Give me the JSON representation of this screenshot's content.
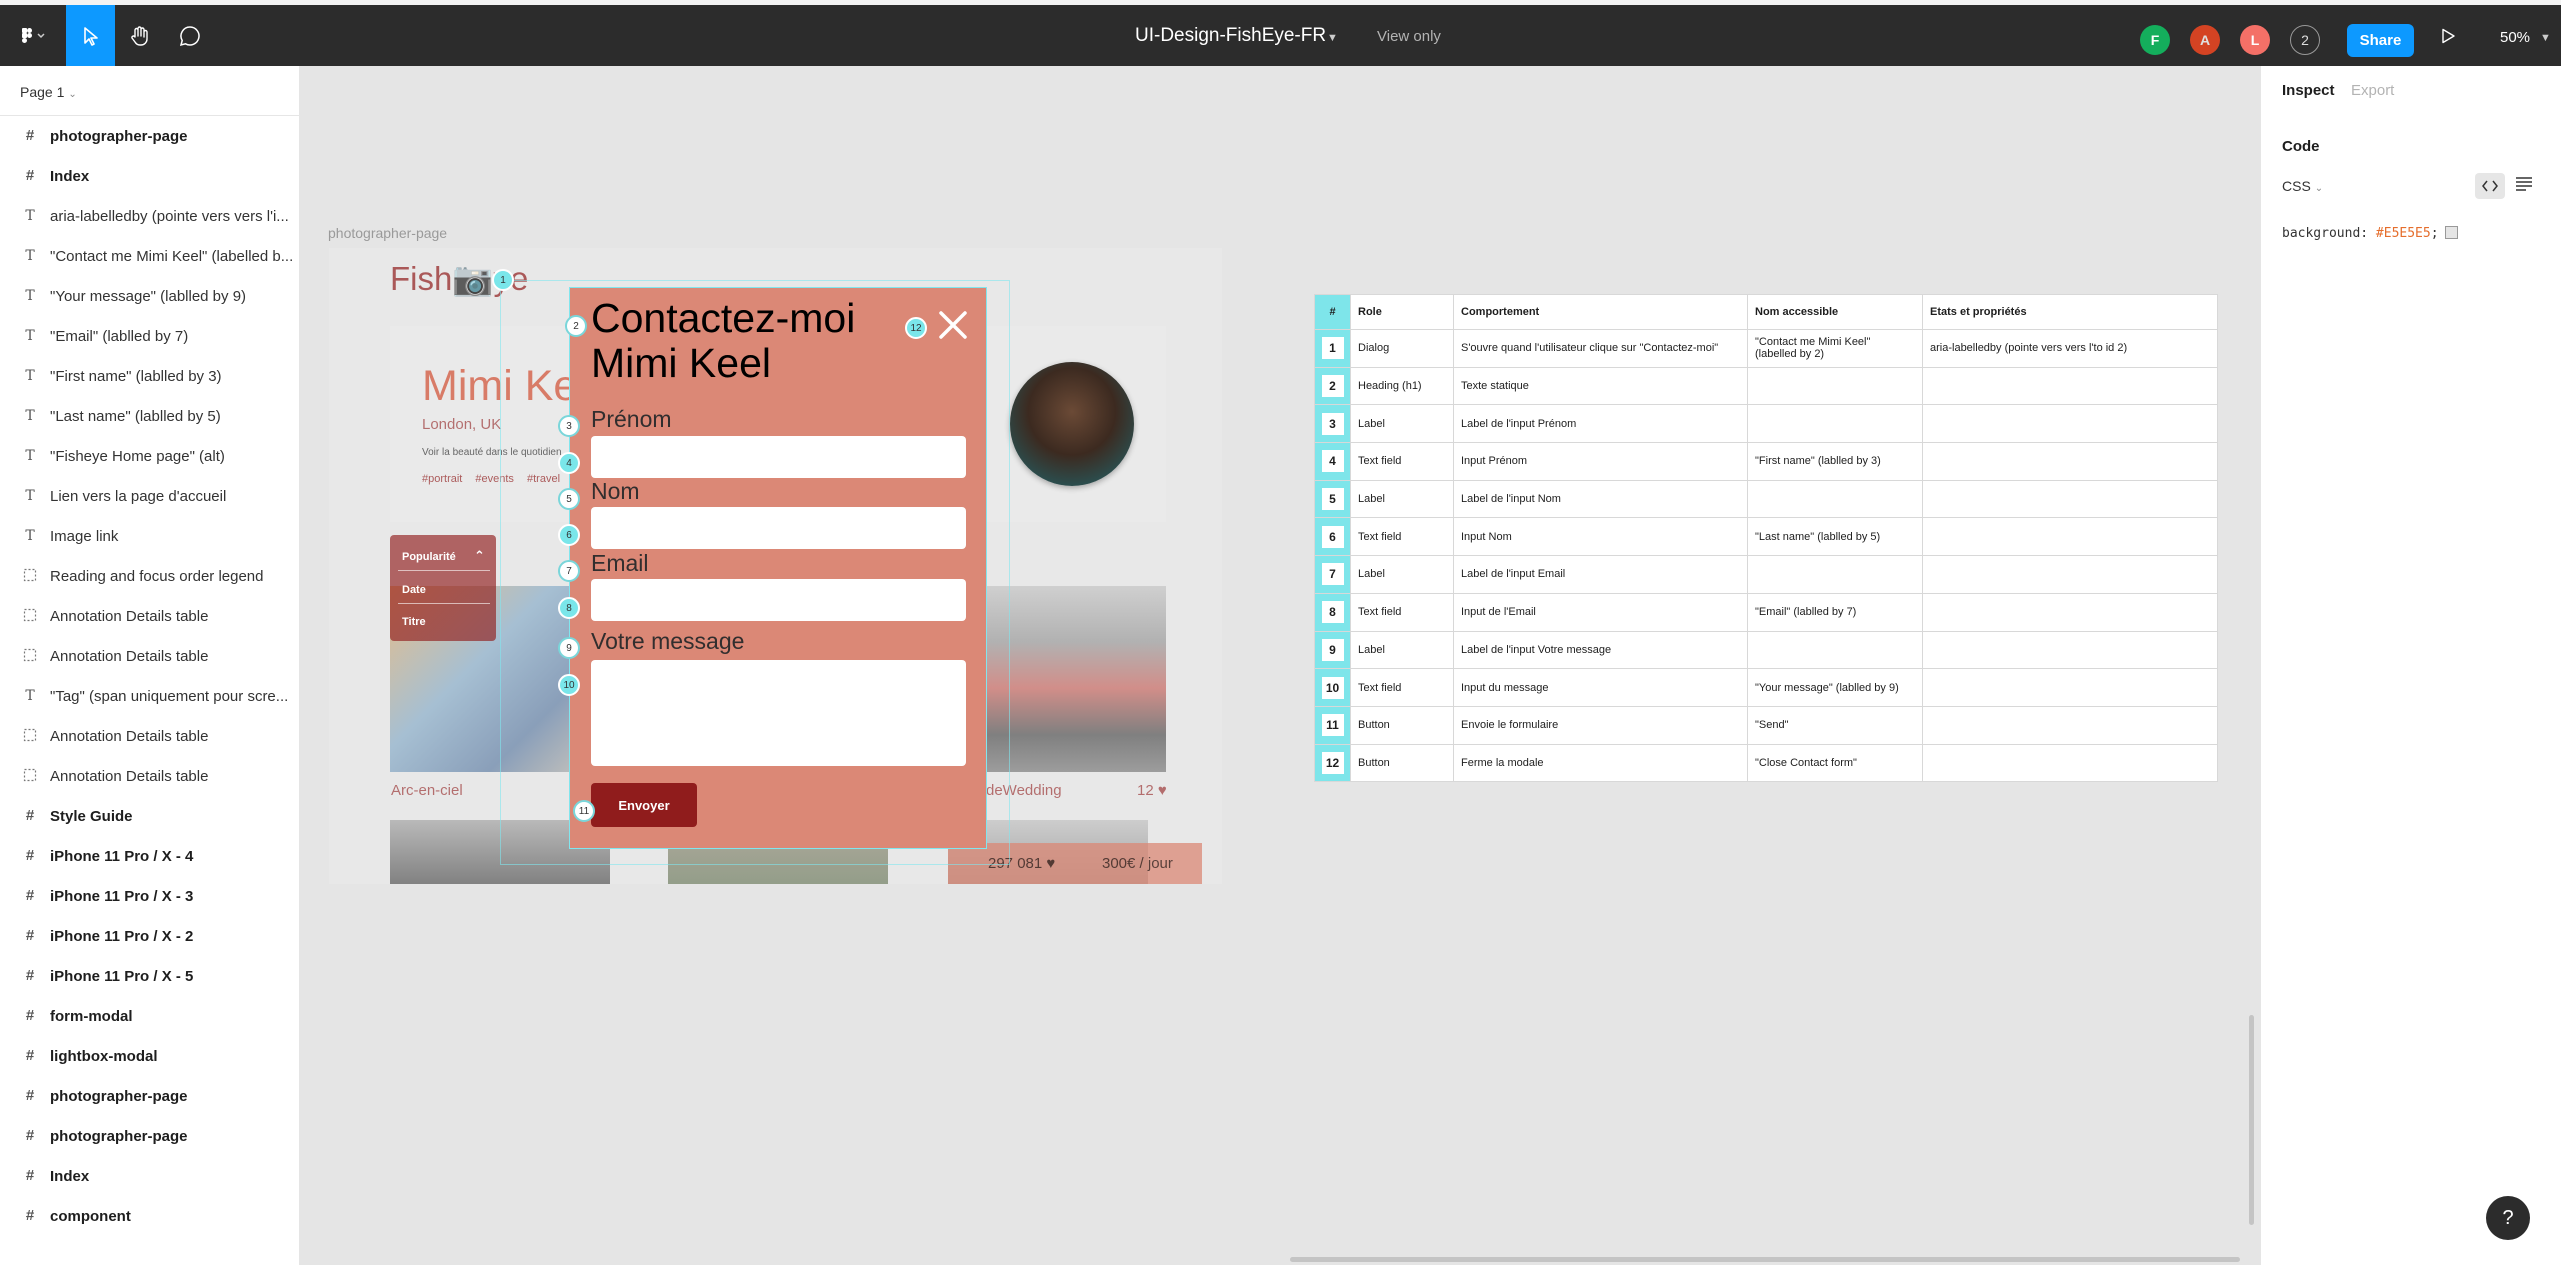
{
  "topbar": {
    "title": "UI-Design-FishEye-FR",
    "view_only": "View only",
    "avatars": [
      "F",
      "A",
      "L"
    ],
    "extra_users": "2",
    "share_label": "Share",
    "zoom": "50%",
    "colors": {
      "bar": "#2c2c2c",
      "accent": "#0d99ff"
    }
  },
  "sidebar": {
    "page": "Page 1",
    "layers": [
      {
        "label": "photographer-page",
        "type": "frame"
      },
      {
        "label": "Index",
        "type": "frame"
      },
      {
        "label": "aria-labelledby (pointe vers vers l'i...",
        "type": "text"
      },
      {
        "label": "\"Contact me Mimi Keel\" (labelled b...",
        "type": "text"
      },
      {
        "label": "\"Your message\" (lablled by 9)",
        "type": "text"
      },
      {
        "label": "\"Email\" (lablled by 7)",
        "type": "text"
      },
      {
        "label": "\"First name\" (lablled by 3)",
        "type": "text"
      },
      {
        "label": "\"Last name\" (lablled by 5)",
        "type": "text"
      },
      {
        "label": "\"Fisheye Home page\" (alt)",
        "type": "text"
      },
      {
        "label": "Lien vers la page d'accueil",
        "type": "text"
      },
      {
        "label": "Image link",
        "type": "text"
      },
      {
        "label": "Reading and focus order legend",
        "type": "group"
      },
      {
        "label": "Annotation Details table",
        "type": "group"
      },
      {
        "label": "Annotation Details table",
        "type": "group"
      },
      {
        "label": "\"Tag\" (span uniquement pour scre...",
        "type": "text"
      },
      {
        "label": "Annotation Details table",
        "type": "group"
      },
      {
        "label": "Annotation Details table",
        "type": "group"
      },
      {
        "label": "Style Guide",
        "type": "frame"
      },
      {
        "label": "iPhone 11 Pro / X - 4",
        "type": "frame"
      },
      {
        "label": "iPhone 11 Pro / X - 3",
        "type": "frame"
      },
      {
        "label": "iPhone 11 Pro / X - 2",
        "type": "frame"
      },
      {
        "label": "iPhone 11 Pro / X - 5",
        "type": "frame"
      },
      {
        "label": "form-modal",
        "type": "frame"
      },
      {
        "label": "lightbox-modal",
        "type": "frame"
      },
      {
        "label": "photographer-page",
        "type": "frame"
      },
      {
        "label": "photographer-page",
        "type": "frame"
      },
      {
        "label": "Index",
        "type": "frame"
      },
      {
        "label": "component",
        "type": "frame"
      }
    ]
  },
  "canvas": {
    "frame_label": "photographer-page",
    "mock": {
      "logo": "FishEye",
      "name": "Mimi Keel",
      "location": "London, UK",
      "tagline": "Voir la beauté dans le quotidien",
      "tags": "#portrait #events #travel",
      "sort": [
        "Popularité",
        "Date",
        "Titre"
      ],
      "caption_1": "Arc-en-ciel",
      "caption_2": "deWedding",
      "likes_2": "12 ♥",
      "total_likes": "297 081 ♥",
      "rate": "300€ / jour"
    },
    "modal": {
      "title": "Contactez-moi Mimi Keel",
      "first_name": "Prénom",
      "last_name": "Nom",
      "email": "Email",
      "message": "Votre message",
      "send": "Envoyer",
      "color": "#db8876",
      "button_color": "#901c1c"
    },
    "badges": [
      "1",
      "2",
      "3",
      "4",
      "5",
      "6",
      "7",
      "8",
      "9",
      "10",
      "11",
      "12"
    ],
    "table": {
      "headers": [
        "#",
        "Role",
        "Comportement",
        "Nom accessible",
        "Etats et propriétés"
      ],
      "rows": [
        [
          "1",
          "Dialog",
          "S'ouvre quand l'utilisateur clique sur \"Contactez-moi\"",
          "\"Contact me Mimi Keel\" (labelled by 2)",
          "aria-labelledby (pointe vers vers l'to id 2)"
        ],
        [
          "2",
          "Heading (h1)",
          "Texte statique",
          "",
          ""
        ],
        [
          "3",
          "Label",
          "Label de l'input Prénom",
          "",
          ""
        ],
        [
          "4",
          "Text field",
          "Input Prénom",
          "\"First name\" (lablled by 3)",
          ""
        ],
        [
          "5",
          "Label",
          "Label de l'input Nom",
          "",
          ""
        ],
        [
          "6",
          "Text field",
          "Input Nom",
          "\"Last name\" (lablled by 5)",
          ""
        ],
        [
          "7",
          "Label",
          "Label de l'input Email",
          "",
          ""
        ],
        [
          "8",
          "Text field",
          "Input de l'Email",
          "\"Email\" (lablled by 7)",
          ""
        ],
        [
          "9",
          "Label",
          "Label de l'input Votre message",
          "",
          ""
        ],
        [
          "10",
          "Text field",
          "Input du message",
          "\"Your message\" (lablled by 9)",
          ""
        ],
        [
          "11",
          "Button",
          "Envoie le formulaire",
          "\"Send\"",
          ""
        ],
        [
          "12",
          "Button",
          "Ferme la modale",
          "\"Close Contact form\"",
          ""
        ]
      ]
    }
  },
  "inspect": {
    "tab_inspect": "Inspect",
    "tab_export": "Export",
    "code_heading": "Code",
    "lang": "CSS",
    "code_prop": "background: ",
    "code_val": "#E5E5E5",
    "code_end": ";"
  },
  "help": "?"
}
